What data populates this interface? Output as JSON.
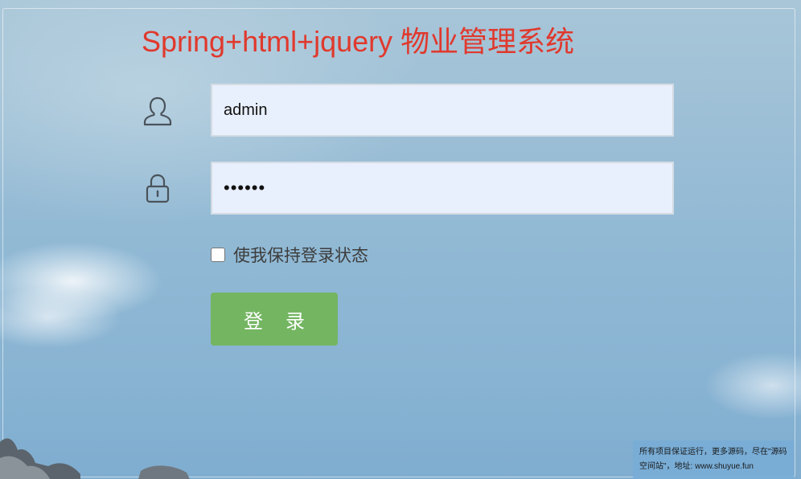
{
  "title": "Spring+html+jquery 物业管理系统",
  "form": {
    "username_value": "admin",
    "password_value": "••••••",
    "remember_label": "使我保持登录状态",
    "remember_checked": false,
    "login_label": "登录"
  },
  "icons": {
    "user": "user-icon",
    "lock": "lock-icon"
  },
  "ad": {
    "line1": "所有项目保证运行，更多源码，尽在\"源码",
    "line2": "空间站\"，地址: www.shuyue.fun"
  },
  "colors": {
    "title": "#e0392d",
    "login_button": "#74b562",
    "field_bg": "#e8effd"
  }
}
